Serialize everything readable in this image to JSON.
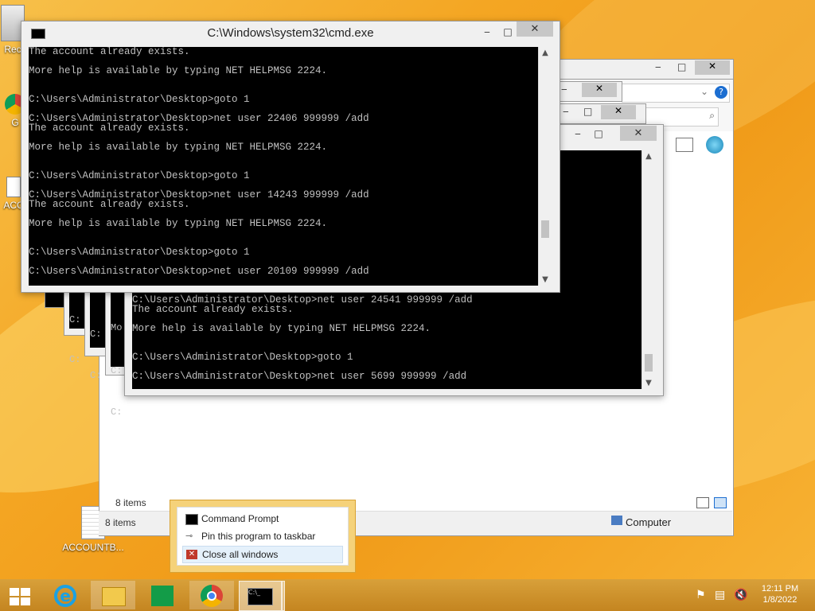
{
  "desktop": {
    "icons": [
      {
        "label": "Rec"
      },
      {
        "label": "G"
      },
      {
        "label": "ACC"
      },
      {
        "label": "ACCOUNTB..."
      }
    ]
  },
  "cmd_window": {
    "title": "C:\\Windows\\system32\\cmd.exe",
    "lines": [
      "The account already exists.",
      "",
      "More help is available by typing NET HELPMSG 2224.",
      "",
      "",
      "C:\\Users\\Administrator\\Desktop>goto 1",
      "",
      "C:\\Users\\Administrator\\Desktop>net user 22406 999999 /add",
      "The account already exists.",
      "",
      "More help is available by typing NET HELPMSG 2224.",
      "",
      "",
      "C:\\Users\\Administrator\\Desktop>goto 1",
      "",
      "C:\\Users\\Administrator\\Desktop>net user 14243 999999 /add",
      "The account already exists.",
      "",
      "More help is available by typing NET HELPMSG 2224.",
      "",
      "",
      "C:\\Users\\Administrator\\Desktop>goto 1",
      "",
      "C:\\Users\\Administrator\\Desktop>net user 20109 999999 /add"
    ]
  },
  "back_console": {
    "lines": [
      "C:\\Users\\Administrator\\Desktop>net user 24541 999999 /add",
      "The account already exists.",
      "",
      "More help is available by typing NET HELPMSG 2224.",
      "",
      "",
      "C:\\Users\\Administrator\\Desktop>goto 1",
      "",
      "C:\\Users\\Administrator\\Desktop>net user 5699 999999 /add"
    ],
    "fragments": [
      "C:",
      "C:",
      "C:",
      "C:",
      "Mo",
      "C:",
      "C:"
    ]
  },
  "explorer": {
    "status_items_inner": "8 items",
    "status_items_outer": "8 items",
    "location": "Computer"
  },
  "jumplist": {
    "items": [
      {
        "label": "Command Prompt"
      },
      {
        "label": "Pin this program to taskbar"
      },
      {
        "label": "Close all windows"
      }
    ]
  },
  "taskbar": {
    "time": "12:11 PM",
    "date": "1/8/2022"
  }
}
